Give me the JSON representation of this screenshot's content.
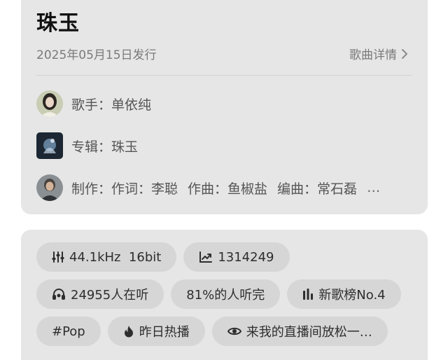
{
  "song": {
    "title": "珠玉",
    "release_date": "2025年05月15日发行",
    "details_link": "歌曲详情"
  },
  "meta": {
    "singer_label": "歌手：",
    "singer": "单依纯",
    "album_label": "专辑：",
    "album": "珠玉",
    "production_label": "制作：",
    "lyricist": "作词：李聪",
    "composer": "作曲：鱼椒盐",
    "arranger": "编曲：常石磊",
    "overflow": "…"
  },
  "tags": {
    "row1": [
      {
        "icon": "equalizer-icon",
        "text": "44.1kHz  16bit"
      },
      {
        "icon": "trend-up-icon",
        "text": "1314249"
      }
    ],
    "row2": [
      {
        "icon": "headphones-icon",
        "text": "24955人在听"
      },
      {
        "icon": "",
        "text": "81%的人听完"
      },
      {
        "icon": "bar-chart-icon",
        "text": "新歌榜No.4"
      }
    ],
    "row3": [
      {
        "icon": "",
        "text": "#Pop"
      },
      {
        "icon": "flame-icon",
        "text": "昨日热播"
      },
      {
        "icon": "eye-icon",
        "text": "来我的直播间放松一…"
      }
    ]
  },
  "colors": {
    "card_bg": "#e6e6e6",
    "chip_bg": "#d6d6d6",
    "muted_text": "#7a7a7a"
  }
}
